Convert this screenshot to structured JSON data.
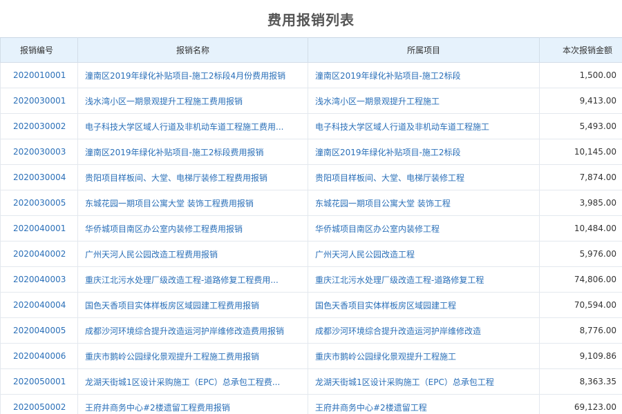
{
  "page": {
    "title": "费用报销列表"
  },
  "table": {
    "headers": {
      "number": "报销编号",
      "name": "报销名称",
      "project": "所属项目",
      "amount": "本次报销金额"
    },
    "rows": [
      {
        "number": "2020010001",
        "name": "潼南区2019年绿化补贴项目-施工2标段4月份费用报销",
        "project": "潼南区2019年绿化补贴项目-施工2标段",
        "amount": "1,500.00"
      },
      {
        "number": "2020030001",
        "name": "浅水湾小区一期景观提升工程施工费用报销",
        "project": "浅水湾小区一期景观提升工程施工",
        "amount": "9,413.00"
      },
      {
        "number": "2020030002",
        "name": "电子科技大学区域人行道及非机动车道工程施工费用...",
        "project": "电子科技大学区域人行道及非机动车道工程施工",
        "amount": "5,493.00"
      },
      {
        "number": "2020030003",
        "name": "潼南区2019年绿化补贴项目-施工2标段费用报销",
        "project": "潼南区2019年绿化补贴项目-施工2标段",
        "amount": "10,145.00"
      },
      {
        "number": "2020030004",
        "name": "贵阳项目样板间、大堂、电梯厅装修工程费用报销",
        "project": "贵阳项目样板间、大堂、电梯厅装修工程",
        "amount": "7,874.00"
      },
      {
        "number": "2020030005",
        "name": "东城花园一期项目公寓大堂 装饰工程费用报销",
        "project": "东城花园一期项目公寓大堂 装饰工程",
        "amount": "3,985.00"
      },
      {
        "number": "2020040001",
        "name": "华侨城项目南区办公室内装修工程费用报销",
        "project": "华侨城项目南区办公室内装修工程",
        "amount": "10,484.00"
      },
      {
        "number": "2020040002",
        "name": "广州天河人民公园改造工程费用报销",
        "project": "广州天河人民公园改造工程",
        "amount": "5,976.00"
      },
      {
        "number": "2020040003",
        "name": "重庆江北污水处理厂级改造工程-道路修复工程费用...",
        "project": "重庆江北污水处理厂级改造工程-道路修复工程",
        "amount": "74,806.00"
      },
      {
        "number": "2020040004",
        "name": "国色天香项目实体样板房区域园建工程费用报销",
        "project": "国色天香项目实体样板房区域园建工程",
        "amount": "70,594.00"
      },
      {
        "number": "2020040005",
        "name": "成都沙河环境综合提升改造运河护岸维修改造费用报销",
        "project": "成都沙河环境综合提升改造运河护岸维修改造",
        "amount": "8,776.00"
      },
      {
        "number": "2020040006",
        "name": "重庆市鹅岭公园绿化景观提升工程施工费用报销",
        "project": "重庆市鹅岭公园绿化景观提升工程施工",
        "amount": "9,109.86"
      },
      {
        "number": "2020050001",
        "name": "龙湖天街城1区设计采购施工（EPC）总承包工程费...",
        "project": "龙湖天街城1区设计采购施工（EPC）总承包工程",
        "amount": "8,363.35"
      },
      {
        "number": "2020050002",
        "name": "王府井商务中心#2楼遗留工程费用报销",
        "project": "王府井商务中心#2楼遗留工程",
        "amount": "69,123.00"
      }
    ]
  },
  "colors": {
    "header_bg": "#e6f2fc",
    "link": "#2a6fb8",
    "title": "#555555",
    "border": "#e3e8ee"
  }
}
